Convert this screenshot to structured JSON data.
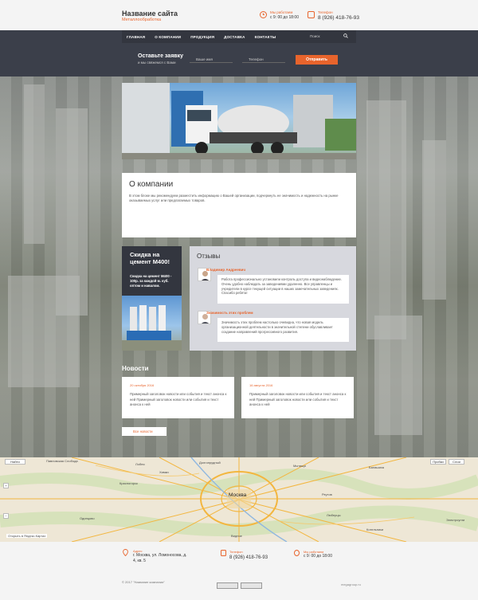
{
  "header": {
    "title": "Название сайта",
    "subtitle": "Металлообработка",
    "hours_label": "Мы работаем",
    "hours_value": "с 9: 00 до 18:00",
    "phone_label": "Телефон",
    "phone_value": "8 (926) 418-76-93"
  },
  "nav": {
    "items": [
      "ГЛАВНАЯ",
      "О КОМПАНИИ",
      "ПРОДУКЦИЯ",
      "ДОСТАВКА",
      "КОНТАКТЫ"
    ],
    "search_placeholder": "Поиск"
  },
  "form": {
    "title": "Оставьте заявку",
    "subtitle": "и мы свяжемся с Вами",
    "name_placeholder": "Ваше имя",
    "phone_placeholder": "Телефон",
    "submit": "Отправить"
  },
  "about": {
    "title": "О компании",
    "text": "В этом блоке мы рекомендуем разместить информацию о Вашей организации, подчеркнуть ее значимость и надежность на рынке оказываемых услуг или предлагаемых товаров."
  },
  "promo": {
    "title": "Скидка на цемент М400!",
    "text": "Скидка на цемент М400 - 100р. за каждой м. куб. оптом и навалом."
  },
  "reviews": {
    "title": "Отзывы",
    "items": [
      {
        "name": "Владимир Андреевич",
        "text": "Работа профессионально установили контроль доступа и видеонаблюдение. Очень удобно наблюдать за заведениями удаленно. Все управленцы и учредители в курсе текущей ситуации в наших замечательных заведениях. Спасибо ребята!"
      },
      {
        "name": "Значимость этих проблем",
        "text": "Значимость этих проблем настолько очевидна, что новая модель организационной деятельности в значительной степени обуславливает создание направлений прогрессивного развития."
      }
    ]
  },
  "news": {
    "title": "Новости",
    "items": [
      {
        "date": "20 октября 2016",
        "text": "Примерный заголовок новости или события и текст анонса к ней Примерный заголовок новости или события и текст анонса к ней"
      },
      {
        "date": "16 августа 2016",
        "text": "Примерный заголовок новости или события и текст анонса к ней Примерный заголовок новости или события и текст анонса к ней"
      }
    ],
    "all_link": "Все новости"
  },
  "map": {
    "find": "Найти",
    "route": "Пробки",
    "layers": "Слои",
    "city": "Москва",
    "open_link": "Открыть в Яндекс.Картах",
    "places": [
      "Павловская Слобода",
      "Балашиха",
      "Реутов",
      "Люберцы",
      "Видное",
      "Долгопрудный",
      "Мытищи",
      "Одинцово",
      "Котельники",
      "Электроугли",
      "Красногорск",
      "Химки",
      "Лобня"
    ]
  },
  "footer": {
    "address_label": "Адрес",
    "address_value": "г. Москва, ул. Ломоносова, д. 4, кв. 5",
    "phone_label": "Телефон",
    "phone_value": "8 (926) 418-76-93",
    "hours_label": "Мы работаем",
    "hours_value": "с 9: 00 до 18:00",
    "copyright": "© 2017 \"Название компании\"",
    "maker": "megagroup.ru"
  },
  "colors": {
    "accent": "#e8642c",
    "dark": "#33363f",
    "band": "#3b3f4a"
  }
}
